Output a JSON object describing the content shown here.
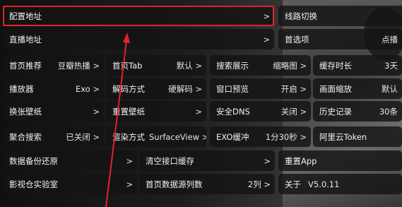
{
  "rows": [
    {
      "cells": [
        {
          "label": "配置地址",
          "value": ">"
        },
        {
          "label": "线路切换",
          "value": ""
        }
      ]
    },
    {
      "cells": [
        {
          "label": "直播地址",
          "value": ">"
        },
        {
          "label": "首选项",
          "value": "点播"
        }
      ]
    },
    {
      "cells": [
        {
          "label": "首页推荐",
          "value": "豆瓣热播 >"
        },
        {
          "label": "首页Tab",
          "value": "默认 >"
        },
        {
          "label": "搜索展示",
          "value": "缩略图 >"
        },
        {
          "label": "缓存时长",
          "value": "3天"
        }
      ]
    },
    {
      "cells": [
        {
          "label": "播放器",
          "value": "Exo >"
        },
        {
          "label": "解码方式",
          "value": "硬解码 >"
        },
        {
          "label": "窗口预览",
          "value": "开启 >"
        },
        {
          "label": "画面缩放",
          "value": "默认"
        }
      ]
    },
    {
      "cells": [
        {
          "label": "换张壁纸",
          "value": ">"
        },
        {
          "label": "重置壁纸",
          "value": ">"
        },
        {
          "label": "安全DNS",
          "value": "关闭 >"
        },
        {
          "label": "历史记录",
          "value": "30条"
        }
      ]
    },
    {
      "cells": [
        {
          "label": "聚合搜索",
          "value": "已关闭 >"
        },
        {
          "label": "渲染方式",
          "value": "SurfaceView >"
        },
        {
          "label": "EXO缓冲",
          "value": "1分30秒 >"
        },
        {
          "label": "阿里云Token",
          "value": ""
        }
      ]
    },
    {
      "cells": [
        {
          "label": "数据备份还原",
          "value": ">"
        },
        {
          "label": "清空接口缓存",
          "value": ">"
        },
        {
          "label": "重置App",
          "value": ""
        }
      ]
    },
    {
      "cells": [
        {
          "label": "影视仓实验室",
          "value": ">"
        },
        {
          "label": "首页数据源列数",
          "value": "2列 >"
        },
        {
          "label": "关于",
          "value": "V5.0.11"
        }
      ]
    }
  ],
  "colors": {
    "highlight": "#e3212a",
    "arrow": "#e3212a"
  }
}
